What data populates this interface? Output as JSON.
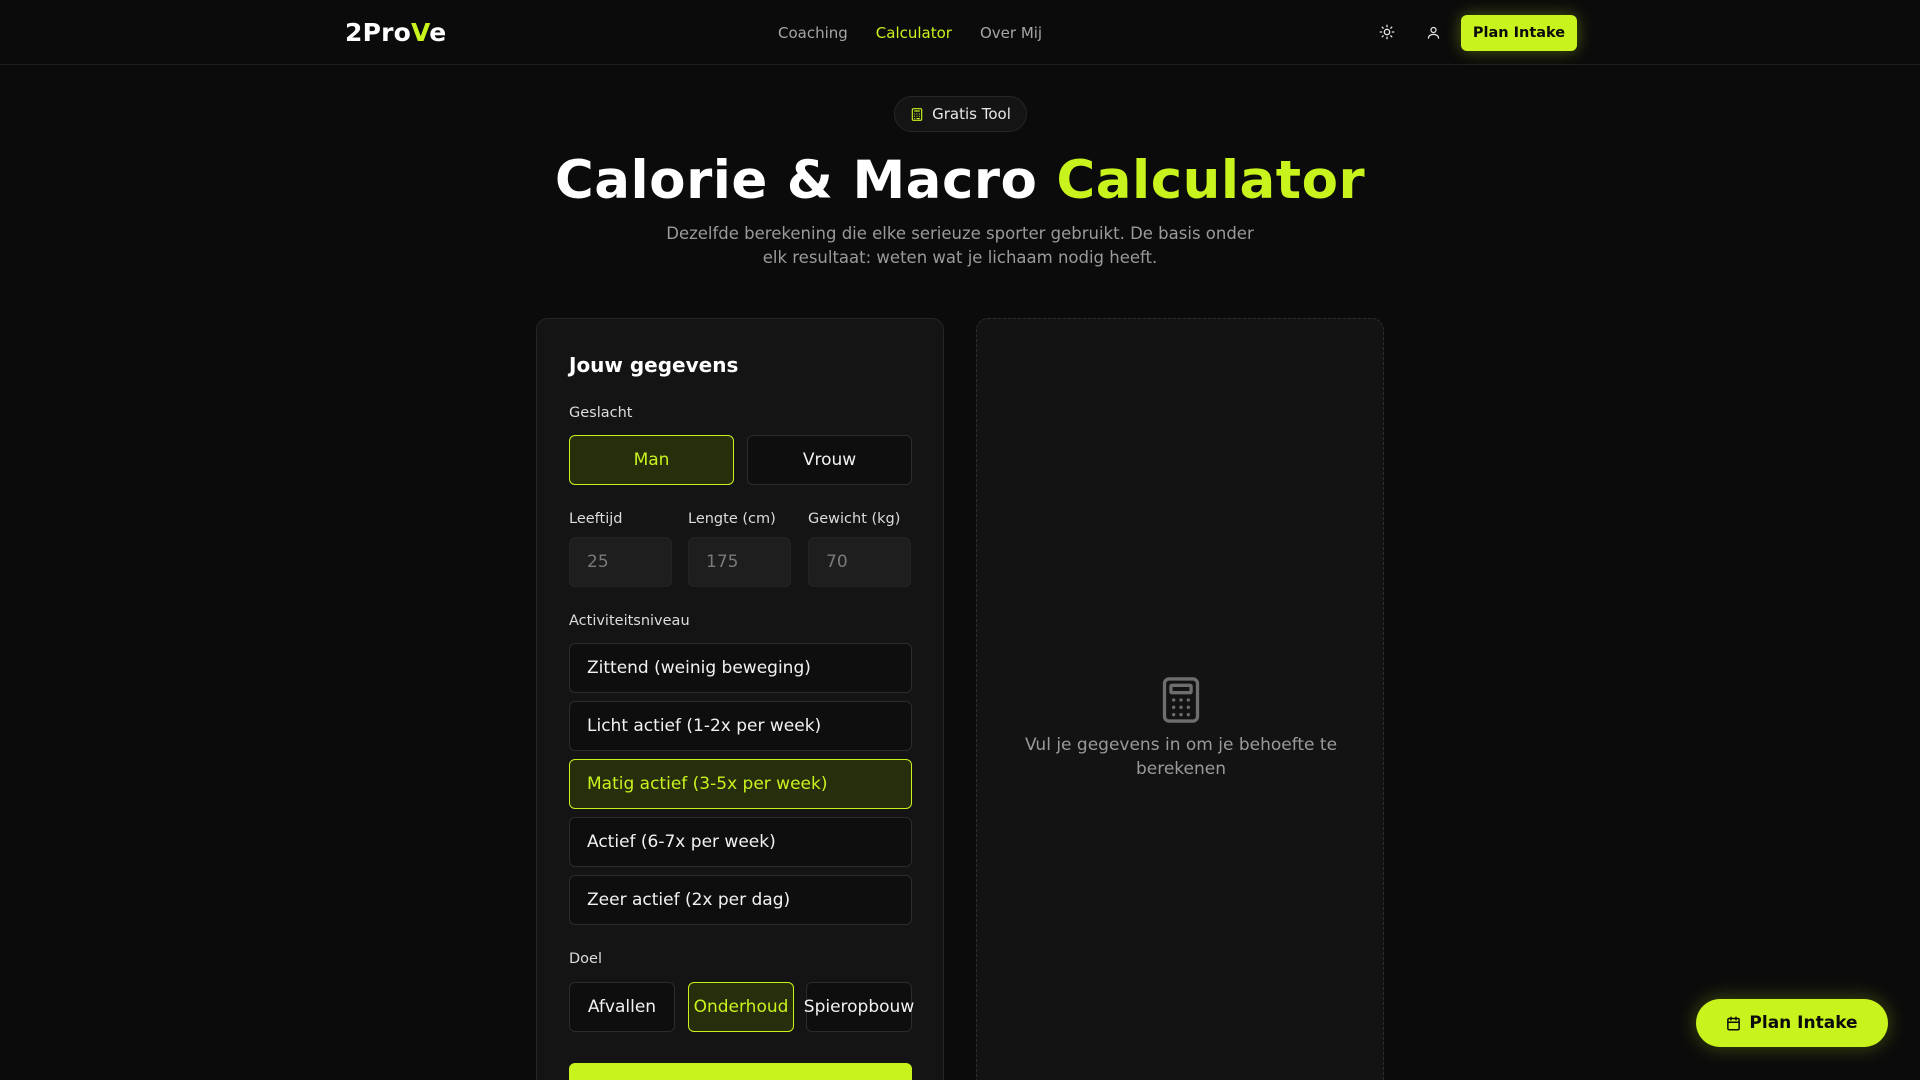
{
  "nav": {
    "logo_prefix": "2Pro",
    "logo_accent": "V",
    "logo_suffix": "e",
    "links": [
      {
        "label": "Coaching",
        "active": false
      },
      {
        "label": "Calculator",
        "active": true
      },
      {
        "label": "Over Mij",
        "active": false
      }
    ],
    "theme_icon": "sun-icon",
    "user_icon": "user-icon",
    "cta_label": "Plan Intake"
  },
  "hero": {
    "badge_icon": "calculator-icon",
    "badge_label": "Gratis Tool",
    "title_main": "Calorie & Macro ",
    "title_accent": "Calculator",
    "subtitle": "Dezelfde berekening die elke serieuze sporter gebruikt. De basis onder elk resultaat: weten wat je lichaam nodig heeft."
  },
  "form": {
    "title": "Jouw gegevens",
    "gender_label": "Geslacht",
    "gender_options": [
      {
        "label": "Man",
        "selected": true
      },
      {
        "label": "Vrouw",
        "selected": false
      }
    ],
    "age_label": "Leeftijd",
    "age_placeholder": "25",
    "height_label": "Lengte (cm)",
    "height_placeholder": "175",
    "weight_label": "Gewicht (kg)",
    "weight_placeholder": "70",
    "activity_label": "Activiteitsniveau",
    "activity_options": [
      {
        "label": "Zittend (weinig beweging)",
        "selected": false
      },
      {
        "label": "Licht actief (1-2x per week)",
        "selected": false
      },
      {
        "label": "Matig actief (3-5x per week)",
        "selected": true
      },
      {
        "label": "Actief (6-7x per week)",
        "selected": false
      },
      {
        "label": "Zeer actief (2x per dag)",
        "selected": false
      }
    ],
    "goal_label": "Doel",
    "goal_options": [
      {
        "label": "Afvallen",
        "selected": false
      },
      {
        "label": "Onderhoud",
        "selected": true
      },
      {
        "label": "Spieropbouw",
        "selected": false
      }
    ]
  },
  "result": {
    "icon": "calculator-icon",
    "empty_text": "Vul je gegevens in om je behoefte te berekenen"
  },
  "fab": {
    "icon": "calendar-icon",
    "label": "Plan Intake"
  },
  "colors": {
    "accent": "#c8f31d",
    "background": "#0b0b0b",
    "card": "#141414"
  }
}
